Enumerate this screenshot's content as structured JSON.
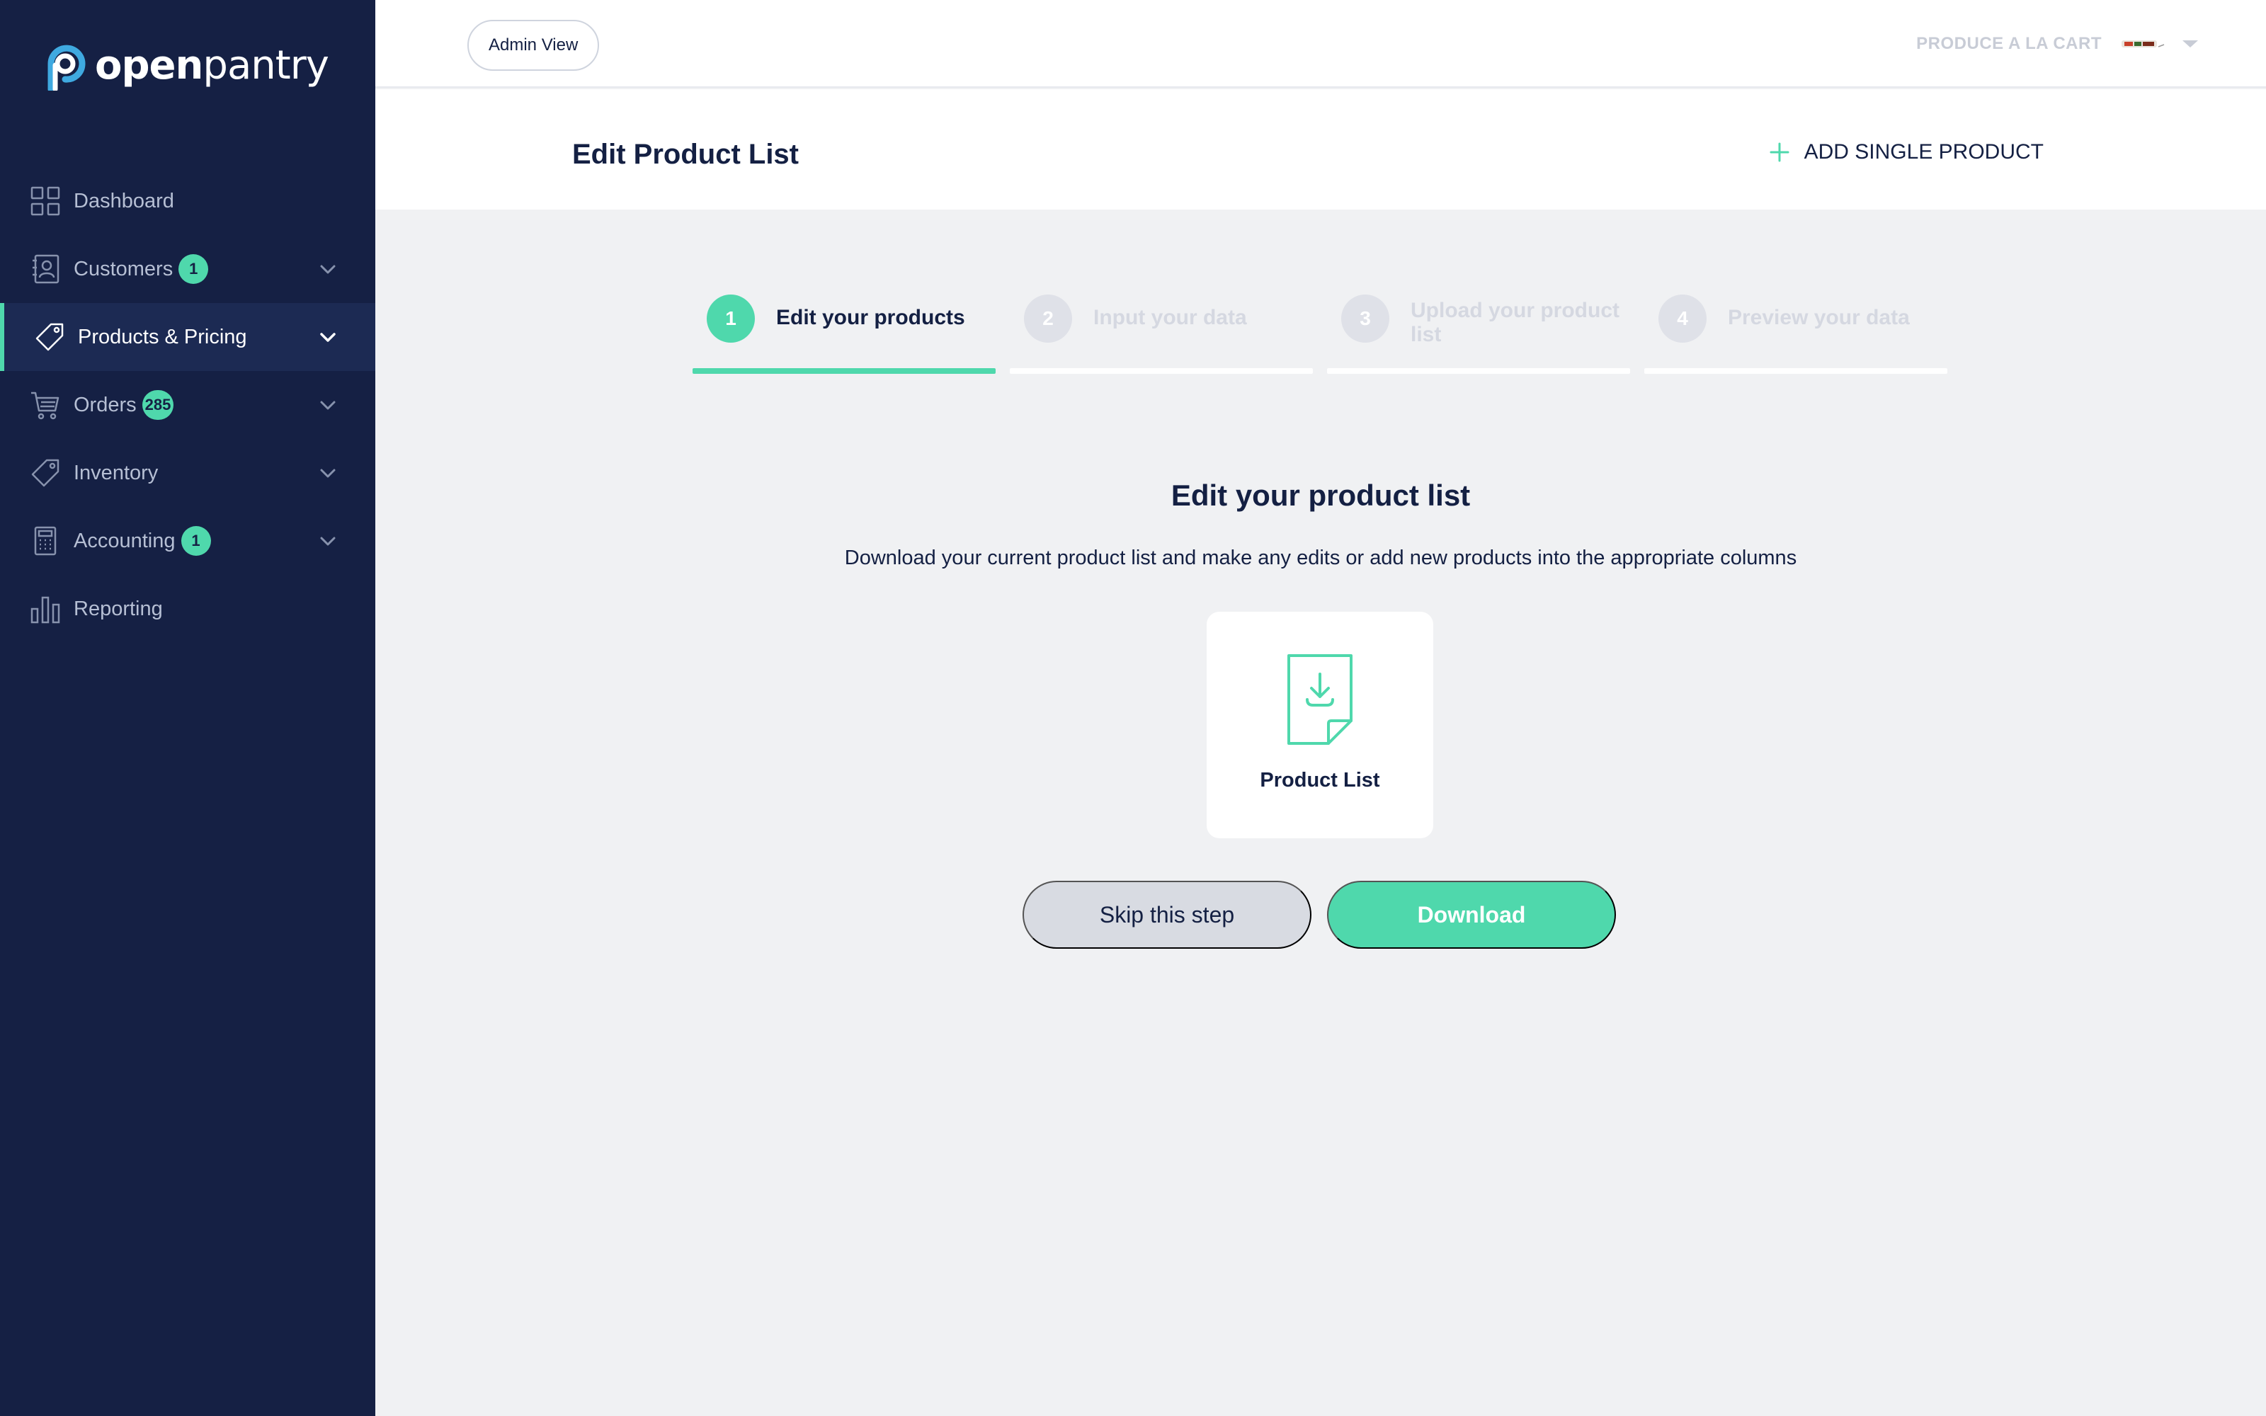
{
  "app": {
    "logo_bold": "open",
    "logo_light": "pantry",
    "accent_color": "#4fd8ac",
    "sidebar_color": "#152044"
  },
  "sidebar": {
    "items": [
      {
        "label": "Dashboard",
        "icon": "grid-icon",
        "badge": null,
        "expandable": false
      },
      {
        "label": "Customers",
        "icon": "contacts-icon",
        "badge": "1",
        "expandable": true
      },
      {
        "label": "Products & Pricing",
        "icon": "tag-icon",
        "badge": null,
        "expandable": true,
        "active": true
      },
      {
        "label": "Orders",
        "icon": "cart-icon",
        "badge": "285",
        "expandable": true
      },
      {
        "label": "Inventory",
        "icon": "tag-icon",
        "badge": null,
        "expandable": true
      },
      {
        "label": "Accounting",
        "icon": "calculator-icon",
        "badge": "1",
        "expandable": true
      },
      {
        "label": "Reporting",
        "icon": "bar-chart-icon",
        "badge": null,
        "expandable": false
      }
    ]
  },
  "topbar": {
    "admin_view_label": "Admin View",
    "account_name": "PRODUCE A LA CART"
  },
  "header": {
    "title": "Edit Product List",
    "add_single_label": "ADD SINGLE PRODUCT"
  },
  "steps": [
    {
      "number": "1",
      "label": "Edit your products",
      "state": "active"
    },
    {
      "number": "2",
      "label": "Input your data",
      "state": "inactive"
    },
    {
      "number": "3",
      "label": "Upload your product list",
      "state": "inactive"
    },
    {
      "number": "4",
      "label": "Preview your data",
      "state": "inactive"
    }
  ],
  "main": {
    "title": "Edit your product list",
    "description": "Download your current product list and make any edits or add new products into the appropriate columns",
    "card_label": "Product List",
    "skip_label": "Skip this step",
    "download_label": "Download"
  }
}
